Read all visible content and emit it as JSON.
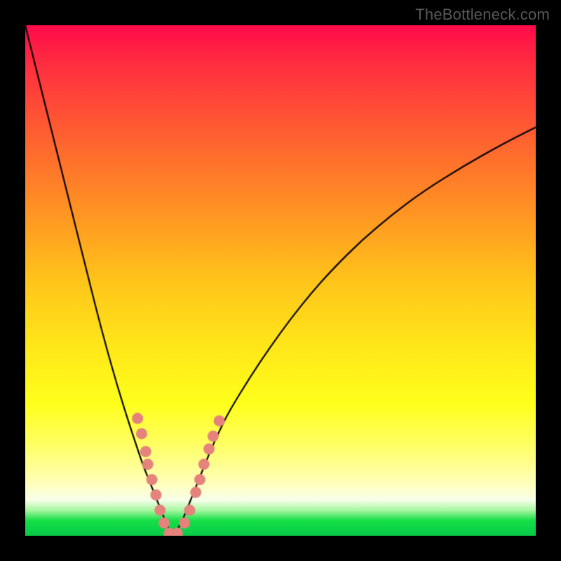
{
  "branding": {
    "watermark": "TheBottleneck.com"
  },
  "colors": {
    "frame": "#000000",
    "curve": "#000000",
    "marker": "#e6827c",
    "gradient_top": "#ff0a4a",
    "gradient_bottom": "#0ac845"
  },
  "chart_data": {
    "type": "line",
    "title": "",
    "xlabel": "",
    "ylabel": "",
    "xlim": [
      0,
      100
    ],
    "ylim": [
      0,
      100
    ],
    "x_optimum": 29,
    "series": [
      {
        "name": "left-branch",
        "x": [
          0,
          2,
          4,
          6,
          8,
          10,
          12,
          14,
          16,
          18,
          20,
          22,
          23,
          24,
          25,
          26,
          27,
          28,
          29
        ],
        "y": [
          100,
          92,
          84,
          76,
          68,
          60,
          52,
          44,
          36.5,
          29.5,
          23,
          17,
          14,
          11.5,
          9,
          6.5,
          4,
          1.5,
          0
        ]
      },
      {
        "name": "right-branch",
        "x": [
          29,
          30,
          31,
          32,
          34,
          36,
          38,
          40,
          44,
          48,
          52,
          56,
          60,
          66,
          72,
          78,
          86,
          94,
          100
        ],
        "y": [
          0,
          1.5,
          3.5,
          6,
          11,
          16,
          20.5,
          24.5,
          31,
          37,
          42.5,
          47.5,
          52,
          58,
          63,
          67.5,
          72.5,
          77,
          80
        ]
      }
    ],
    "markers": {
      "name": "highlight-points",
      "points": [
        {
          "x": 22.0,
          "y": 23.0
        },
        {
          "x": 22.8,
          "y": 20.0
        },
        {
          "x": 23.6,
          "y": 16.5
        },
        {
          "x": 24.0,
          "y": 14.0
        },
        {
          "x": 24.8,
          "y": 11.0
        },
        {
          "x": 25.6,
          "y": 8.0
        },
        {
          "x": 26.4,
          "y": 5.0
        },
        {
          "x": 27.2,
          "y": 2.5
        },
        {
          "x": 28.2,
          "y": 0.5
        },
        {
          "x": 29.8,
          "y": 0.5
        },
        {
          "x": 31.2,
          "y": 2.5
        },
        {
          "x": 32.2,
          "y": 5.0
        },
        {
          "x": 33.4,
          "y": 8.5
        },
        {
          "x": 34.2,
          "y": 11.0
        },
        {
          "x": 35.0,
          "y": 14.0
        },
        {
          "x": 36.0,
          "y": 17.0
        },
        {
          "x": 36.8,
          "y": 19.5
        },
        {
          "x": 38.0,
          "y": 22.5
        }
      ]
    }
  }
}
